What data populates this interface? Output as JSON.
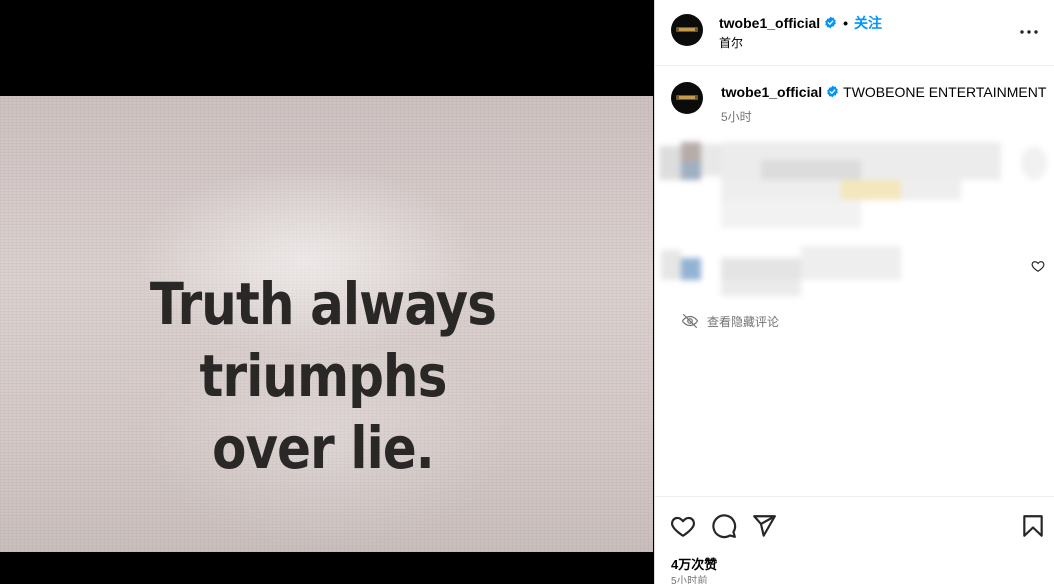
{
  "post": {
    "image_text": "Truth always triumphs over lie.",
    "username": "twobe1_official",
    "location": "首尔",
    "follow_label": "关注",
    "separator": "•",
    "caption_text": "TWOBEONE ENTERTAINMENT",
    "caption_time": "5小时",
    "hidden_comments_label": "查看隐藏评论",
    "likes": "4万次赞",
    "posted_ago": "5小时前"
  },
  "icons": {
    "verified": "verified-badge-icon",
    "more": "more-options-icon",
    "like": "heart-icon",
    "comment": "comment-icon",
    "share": "share-icon",
    "save": "bookmark-icon",
    "hidden": "eye-off-icon"
  },
  "colors": {
    "accent": "#0095f6",
    "secondary_text": "#737373",
    "verified": "#0095f6"
  }
}
